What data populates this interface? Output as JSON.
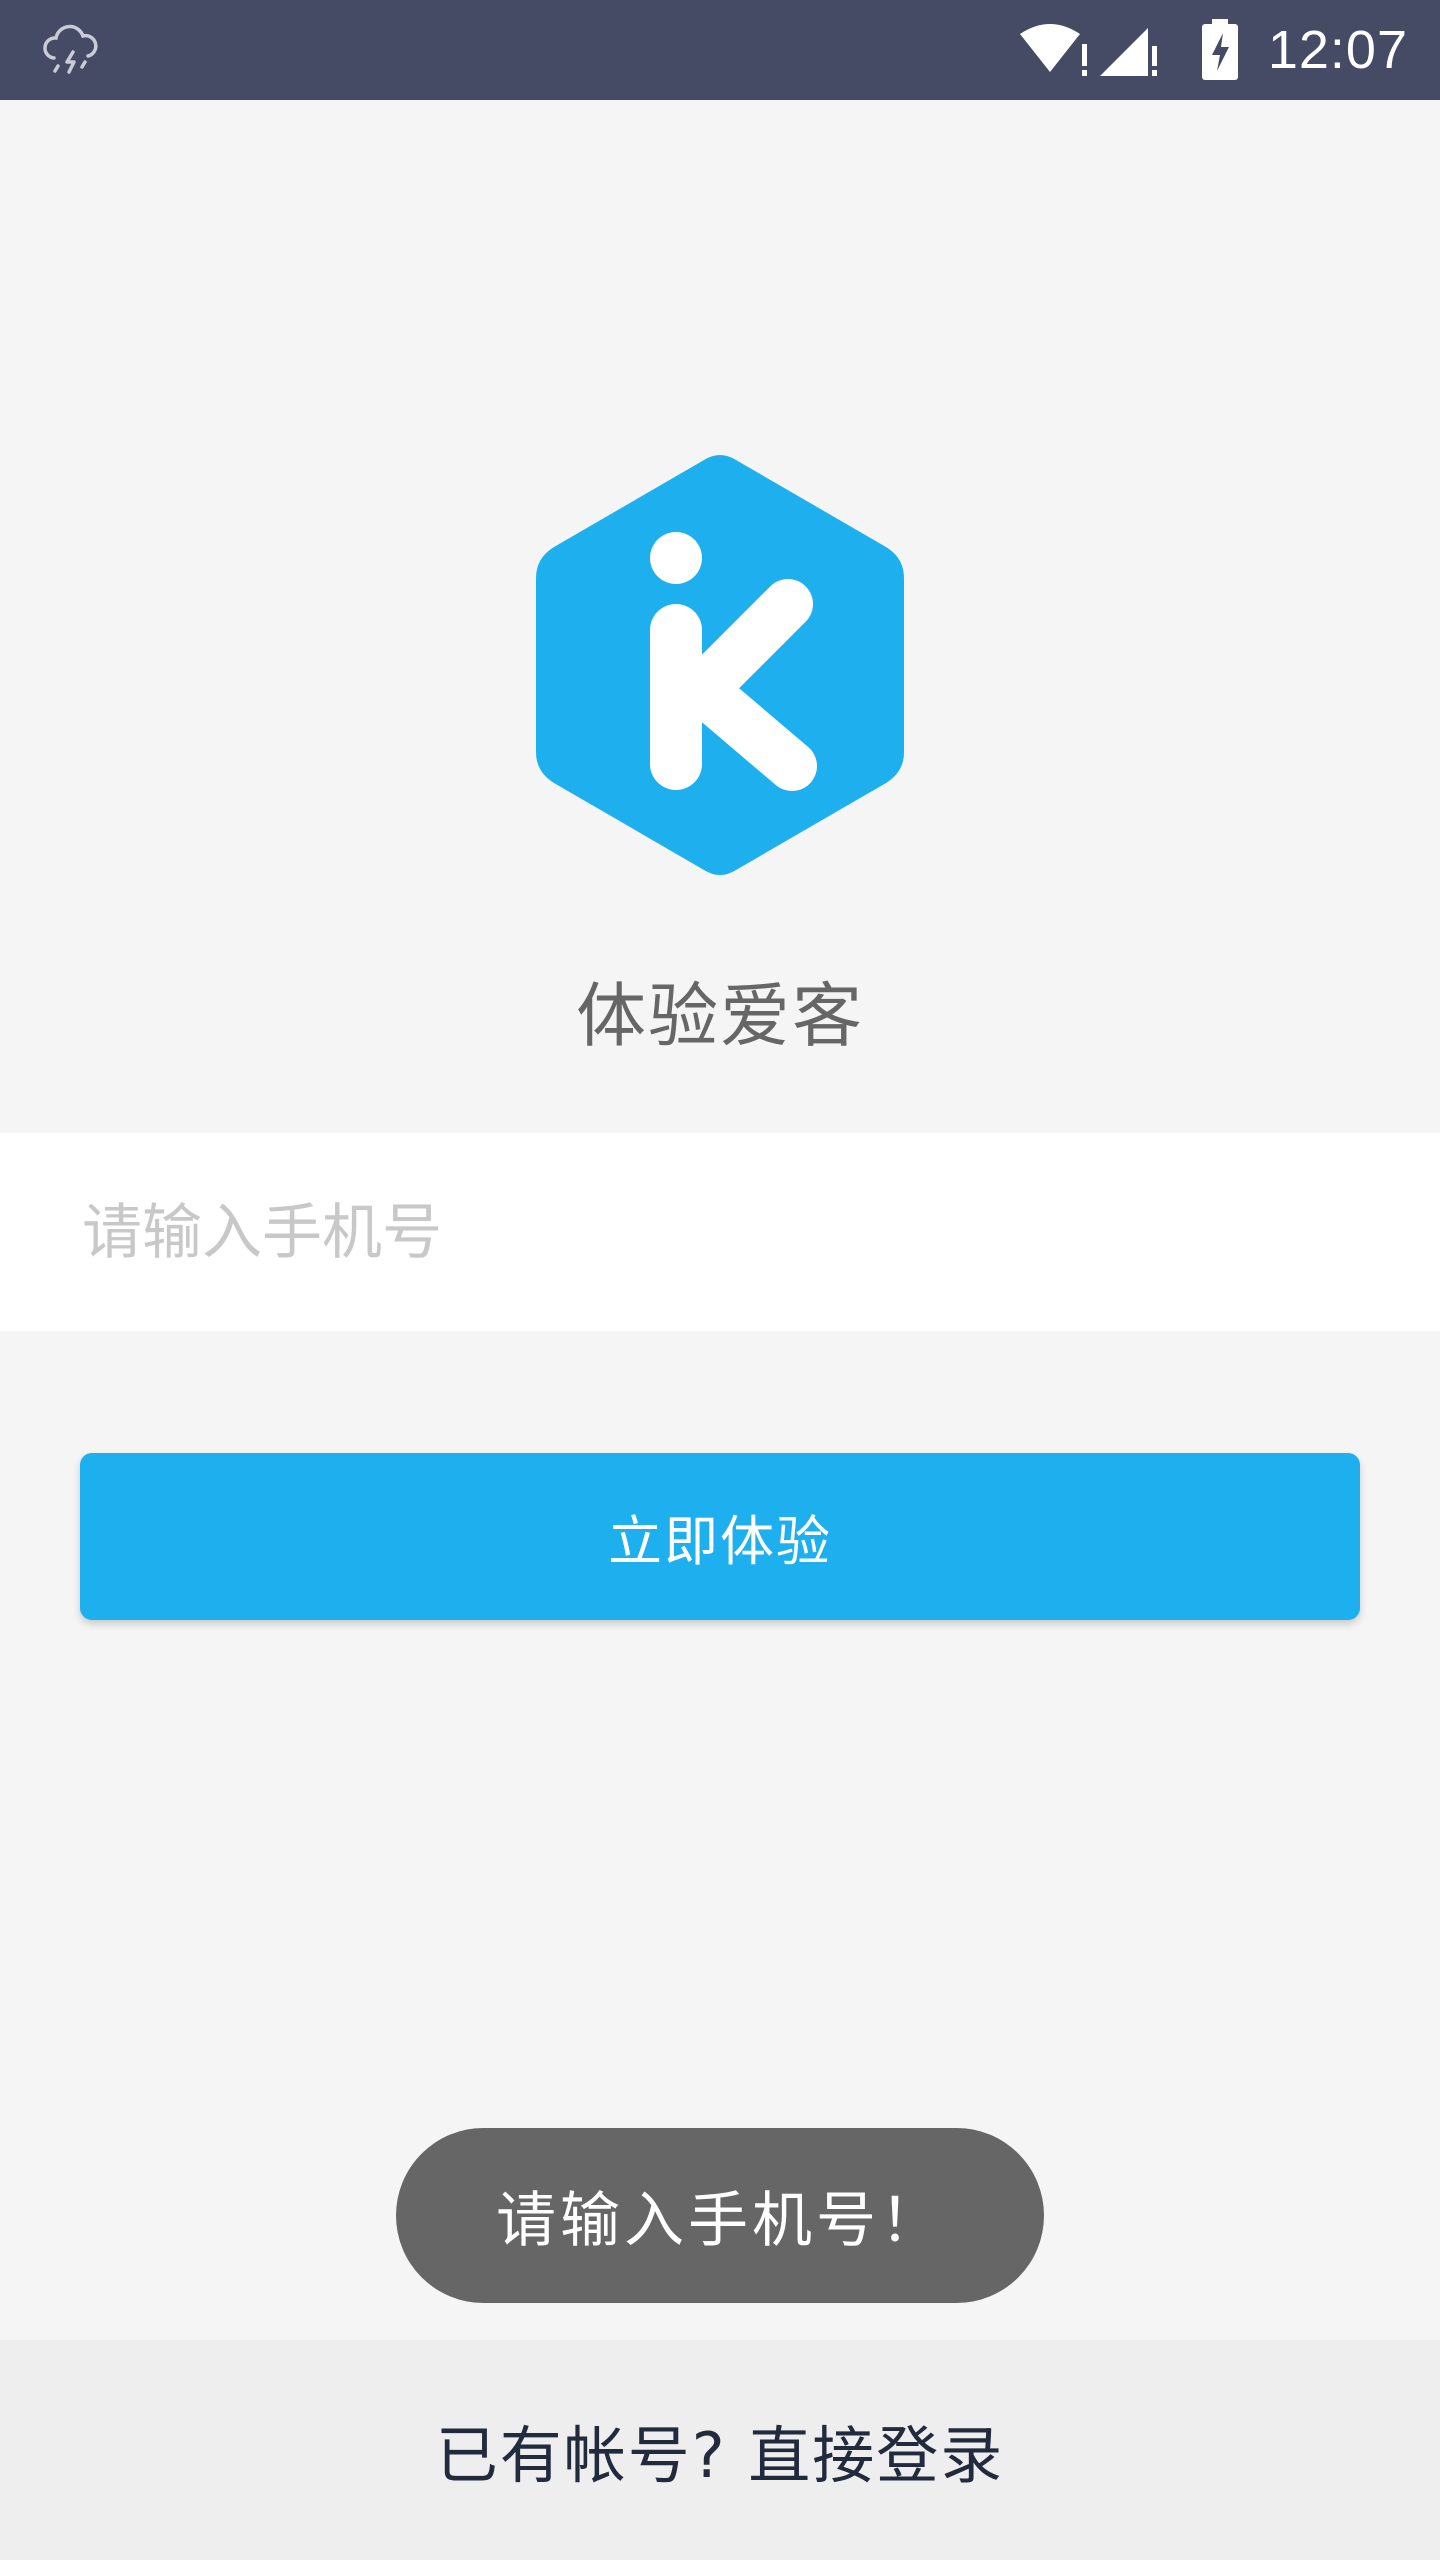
{
  "status_bar": {
    "time": "12:07",
    "icons": [
      "weather-thunderstorm-icon",
      "wifi-alert-icon",
      "signal-alert-icon",
      "battery-charging-icon"
    ]
  },
  "app": {
    "name": "体验爱客",
    "brand_color": "#1eb0ee"
  },
  "phone_field": {
    "placeholder": "请输入手机号",
    "value": ""
  },
  "try_button": {
    "label": "立即体验"
  },
  "toast": {
    "message": "请输入手机号！"
  },
  "footer": {
    "login_link": "已有帐号? 直接登录"
  }
}
